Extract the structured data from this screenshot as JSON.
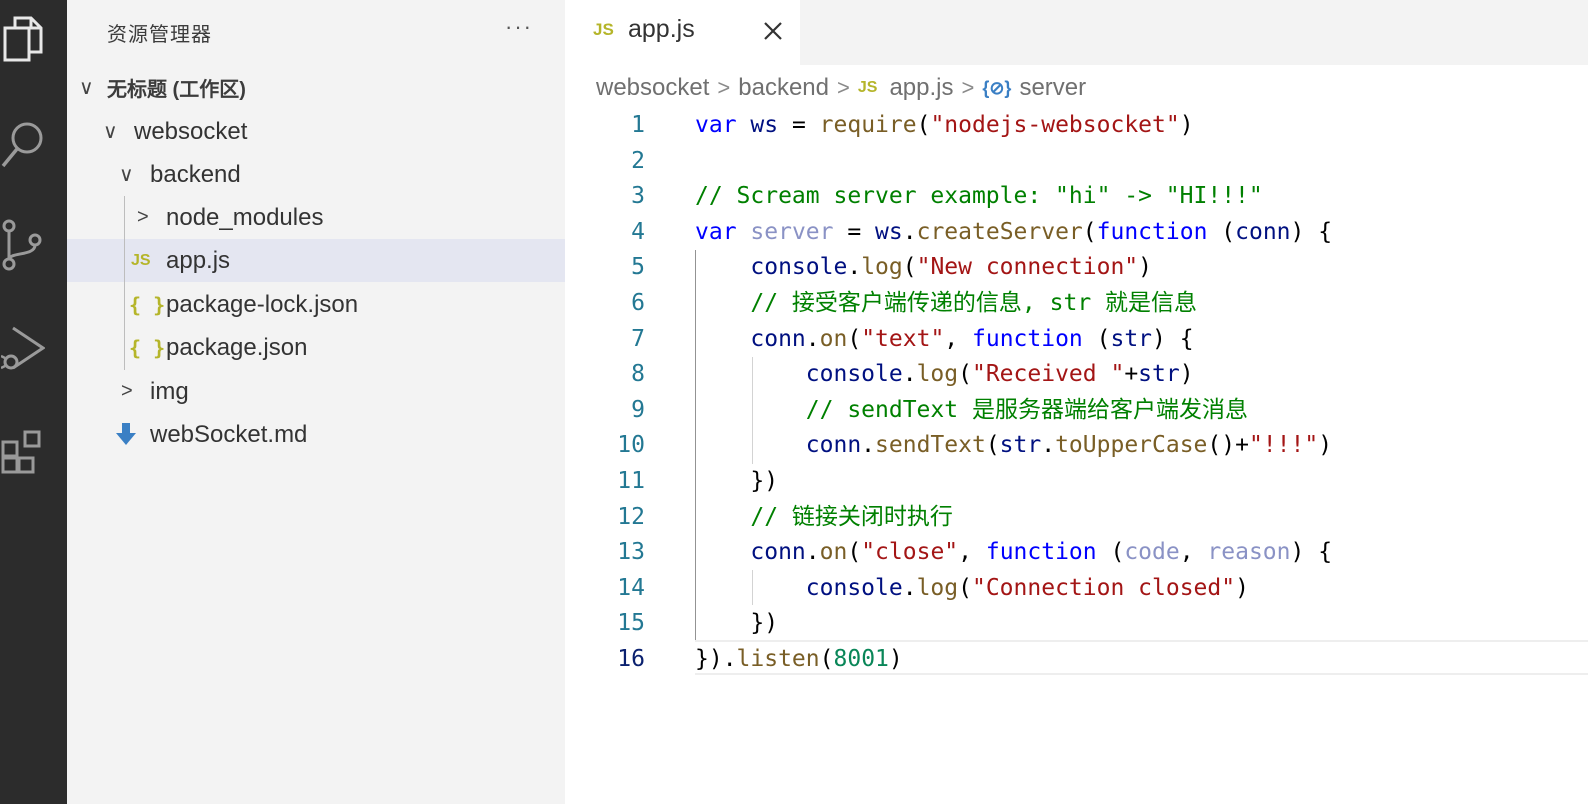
{
  "explorer": {
    "title": "资源管理器",
    "more": "···",
    "tree": [
      {
        "label": "无标题 (工作区)",
        "chevron": "∨",
        "icon": "",
        "selected": false
      },
      {
        "label": "websocket",
        "chevron": "∨",
        "icon": "",
        "selected": false
      },
      {
        "label": "backend",
        "chevron": "∨",
        "icon": "",
        "selected": false
      },
      {
        "label": "node_modules",
        "chevron": ">",
        "icon": "",
        "selected": false
      },
      {
        "label": "app.js",
        "chevron": "",
        "icon": "JS",
        "selected": true
      },
      {
        "label": "package-lock.json",
        "chevron": "",
        "icon": "{ }",
        "selected": false
      },
      {
        "label": "package.json",
        "chevron": "",
        "icon": "{ }",
        "selected": false
      },
      {
        "label": "img",
        "chevron": ">",
        "icon": "",
        "selected": false
      },
      {
        "label": "webSocket.md",
        "chevron": "",
        "icon": "markdown-download-icon",
        "selected": false
      }
    ]
  },
  "tab": {
    "badge": "JS",
    "name": "app.js"
  },
  "breadcrumb": {
    "items": [
      "websocket",
      "backend",
      "app.js",
      "server"
    ],
    "sep": ">",
    "js_badge": "JS",
    "symbol_glyph": "{⊘}"
  },
  "code": {
    "active_line": 16,
    "lines": [
      {
        "n": "1",
        "t": "var ws = require(\"nodejs-websocket\")"
      },
      {
        "n": "2",
        "t": ""
      },
      {
        "n": "3",
        "t": "// Scream server example: \"hi\" -> \"HI!!!\""
      },
      {
        "n": "4",
        "t": "var server = ws.createServer(function (conn) {"
      },
      {
        "n": "5",
        "t": "    console.log(\"New connection\")"
      },
      {
        "n": "6",
        "t": "    // 接受客户端传递的信息, str 就是信息"
      },
      {
        "n": "7",
        "t": "    conn.on(\"text\", function (str) {"
      },
      {
        "n": "8",
        "t": "        console.log(\"Received \"+str)"
      },
      {
        "n": "9",
        "t": "        // sendText 是服务器端给客户端发消息"
      },
      {
        "n": "10",
        "t": "        conn.sendText(str.toUpperCase()+\"!!!\")"
      },
      {
        "n": "11",
        "t": "    })"
      },
      {
        "n": "12",
        "t": "    // 链接关闭时执行"
      },
      {
        "n": "13",
        "t": "    conn.on(\"close\", function (code, reason) {"
      },
      {
        "n": "14",
        "t": "        console.log(\"Connection closed\")"
      },
      {
        "n": "15",
        "t": "    })"
      },
      {
        "n": "16",
        "t": "}).listen(8001)"
      }
    ]
  },
  "colors": {
    "activity_bar": "#2c2c2c",
    "sidebar": "#f3f3f3",
    "selected_row": "#e4e6f1",
    "keyword": "#0000ff",
    "string": "#a31515",
    "comment": "#008000",
    "line_number": "#237893"
  }
}
